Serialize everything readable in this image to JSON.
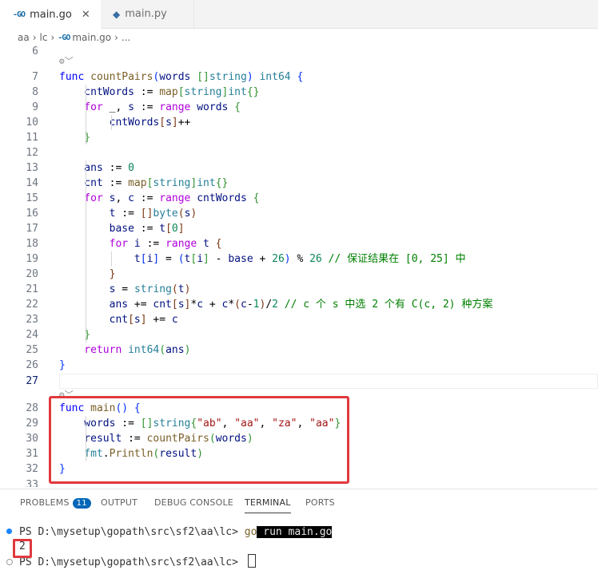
{
  "tabs": [
    {
      "icon": "go-file-icon",
      "label": "main.go",
      "active": true
    },
    {
      "icon": "python-file-icon",
      "label": "main.py",
      "active": false
    }
  ],
  "tab_close_glyph": "✕",
  "breadcrumb": {
    "items": [
      "aa",
      "lc",
      "main.go",
      "..."
    ]
  },
  "codelens_glyph": "⚙︎",
  "editor": {
    "line_numbers": [
      "6",
      "7",
      "8",
      "9",
      "10",
      "11",
      "12",
      "13",
      "14",
      "15",
      "16",
      "17",
      "18",
      "19",
      "20",
      "21",
      "22",
      "23",
      "24",
      "25",
      "26",
      "27",
      "28",
      "29",
      "30",
      "31",
      "32",
      "33"
    ],
    "current_line": "27",
    "lines": {
      "l7": [
        [
          "kw",
          "func"
        ],
        [
          "",
          ""
        ],
        [
          "fn",
          " countPairs"
        ],
        [
          "br1",
          "("
        ],
        [
          "var",
          "words"
        ],
        [
          "",
          ""
        ],
        [
          "",
          ""
        ],
        [
          "br2",
          " []"
        ],
        [
          "ty",
          "string"
        ],
        [
          "br1",
          ")"
        ],
        [
          "ty",
          " int64"
        ],
        [
          "br1",
          " {"
        ]
      ],
      "l8": [
        [
          "var",
          "    cntWords"
        ],
        [
          "",
          " := "
        ],
        [
          "fn",
          "map"
        ],
        [
          "br2",
          "["
        ],
        [
          "ty",
          "string"
        ],
        [
          "br2",
          "]"
        ],
        [
          "ty",
          "int"
        ],
        [
          "br2",
          "{}"
        ]
      ],
      "l9": [
        [
          "ctl",
          "    for"
        ],
        [
          "",
          " _, "
        ],
        [
          "var",
          "s"
        ],
        [
          "",
          " := "
        ],
        [
          "ctl",
          "range"
        ],
        [
          "var",
          " words"
        ],
        [
          "br2",
          " {"
        ]
      ],
      "l10": [
        [
          "var",
          "        cntWords"
        ],
        [
          "br3",
          "["
        ],
        [
          "var",
          "s"
        ],
        [
          "br3",
          "]"
        ],
        [
          "",
          "++"
        ]
      ],
      "l11": [
        [
          "br2",
          "    }"
        ]
      ],
      "l13": [
        [
          "var",
          "    ans"
        ],
        [
          "",
          " := "
        ],
        [
          "num",
          "0"
        ]
      ],
      "l14": [
        [
          "var",
          "    cnt"
        ],
        [
          "",
          " := "
        ],
        [
          "fn",
          "map"
        ],
        [
          "br2",
          "["
        ],
        [
          "ty",
          "string"
        ],
        [
          "br2",
          "]"
        ],
        [
          "ty",
          "int"
        ],
        [
          "br2",
          "{}"
        ]
      ],
      "l15": [
        [
          "ctl",
          "    for"
        ],
        [
          "var",
          " s"
        ],
        [
          ", ",
          ""
        ],
        [
          "var",
          "c"
        ],
        [
          "",
          " := "
        ],
        [
          "ctl",
          "range"
        ],
        [
          "var",
          " cntWords"
        ],
        [
          "br2",
          " {"
        ]
      ],
      "l16": [
        [
          "var",
          "        t"
        ],
        [
          "",
          " := "
        ],
        [
          "br3",
          "[]"
        ],
        [
          "ty",
          "byte"
        ],
        [
          "br3",
          "("
        ],
        [
          "var",
          "s"
        ],
        [
          "br3",
          ")"
        ]
      ],
      "l17": [
        [
          "var",
          "        base"
        ],
        [
          "",
          " := "
        ],
        [
          "var",
          "t"
        ],
        [
          "br3",
          "["
        ],
        [
          "num",
          "0"
        ],
        [
          "br3",
          "]"
        ]
      ],
      "l18": [
        [
          "ctl",
          "        for"
        ],
        [
          "var",
          " i"
        ],
        [
          "",
          " := "
        ],
        [
          "ctl",
          "range"
        ],
        [
          "var",
          " t"
        ],
        [
          "br3",
          " {"
        ]
      ],
      "l19": [
        [
          "var",
          "            t"
        ],
        [
          "br1",
          "["
        ],
        [
          "var",
          "i"
        ],
        [
          "br1",
          "]"
        ],
        [
          "",
          " = "
        ],
        [
          "br1",
          "("
        ],
        [
          "var",
          "t"
        ],
        [
          "br2",
          "["
        ],
        [
          "var",
          "i"
        ],
        [
          "br2",
          "]"
        ],
        [
          "",
          " - "
        ],
        [
          "var",
          "base"
        ],
        [
          "",
          " + "
        ],
        [
          "num",
          "26"
        ],
        [
          "br1",
          ")"
        ],
        [
          "",
          " % "
        ],
        [
          "num",
          "26"
        ],
        [
          "cm",
          " // 保证结果在 [0, 25] 中"
        ]
      ],
      "l20": [
        [
          "br3",
          "        }"
        ]
      ],
      "l21": [
        [
          "var",
          "        s"
        ],
        [
          "",
          " = "
        ],
        [
          "ty",
          "string"
        ],
        [
          "br3",
          "("
        ],
        [
          "var",
          "t"
        ],
        [
          "br3",
          ")"
        ]
      ],
      "l22": [
        [
          "var",
          "        ans"
        ],
        [
          "",
          " += "
        ],
        [
          "var",
          "cnt"
        ],
        [
          "br3",
          "["
        ],
        [
          "var",
          "s"
        ],
        [
          "br3",
          "]"
        ],
        [
          "",
          "*"
        ],
        [
          "var",
          "c"
        ],
        [
          "",
          " + "
        ],
        [
          "var",
          "c"
        ],
        [
          "",
          "*"
        ],
        [
          "br3",
          "("
        ],
        [
          "var",
          "c"
        ],
        [
          "",
          "-"
        ],
        [
          "num",
          "1"
        ],
        [
          "br3",
          ")"
        ],
        [
          "",
          "/"
        ],
        [
          "num",
          "2"
        ],
        [
          "cm",
          " // c 个 s 中选 2 个有 C(c, 2) 种方案"
        ]
      ],
      "l23": [
        [
          "var",
          "        cnt"
        ],
        [
          "br3",
          "["
        ],
        [
          "var",
          "s"
        ],
        [
          "br3",
          "]"
        ],
        [
          "",
          " += "
        ],
        [
          "var",
          "c"
        ]
      ],
      "l24": [
        [
          "br2",
          "    }"
        ]
      ],
      "l25": [
        [
          "ctl",
          "    return"
        ],
        [
          "ty",
          " int64"
        ],
        [
          "br2",
          "("
        ],
        [
          "var",
          "ans"
        ],
        [
          "br2",
          ")"
        ]
      ],
      "l26": [
        [
          "br1",
          "}"
        ]
      ],
      "l28": [
        [
          "kw",
          "func"
        ],
        [
          "fn",
          " main"
        ],
        [
          "br1",
          "()"
        ],
        [
          "br1",
          " {"
        ]
      ],
      "l29": [
        [
          "var",
          "    words"
        ],
        [
          "",
          " := "
        ],
        [
          "br2",
          "[]"
        ],
        [
          "ty",
          "string"
        ],
        [
          "br2",
          "{"
        ],
        [
          "str",
          "\"ab\""
        ],
        [
          "",
          ", "
        ],
        [
          "str",
          "\"aa\""
        ],
        [
          "",
          ", "
        ],
        [
          "str",
          "\"za\""
        ],
        [
          "",
          ", "
        ],
        [
          "str",
          "\"aa\""
        ],
        [
          "br2",
          "}"
        ]
      ],
      "l30": [
        [
          "var",
          "    result"
        ],
        [
          "",
          " := "
        ],
        [
          "fn",
          "countPairs"
        ],
        [
          "br2",
          "("
        ],
        [
          "var",
          "words"
        ],
        [
          "br2",
          ")"
        ]
      ],
      "l31": [
        [
          "ty",
          "    fmt"
        ],
        [
          "",
          "."
        ],
        [
          "fn",
          "Println"
        ],
        [
          "br2",
          "("
        ],
        [
          "var",
          "result"
        ],
        [
          "br2",
          ")"
        ]
      ],
      "l32": [
        [
          "br1",
          "}"
        ]
      ]
    }
  },
  "panel": {
    "tabs": [
      {
        "label": "PROBLEMS",
        "badge": "11"
      },
      {
        "label": "OUTPUT"
      },
      {
        "label": "DEBUG CONSOLE"
      },
      {
        "label": "TERMINAL",
        "active": true
      },
      {
        "label": "PORTS"
      }
    ]
  },
  "terminal": {
    "prompt1": "PS D:\\mysetup\\gopath\\src\\sf2\\aa\\lc> ",
    "cmd_go": "go",
    "cmd_rest": " run main.go",
    "output": "2",
    "prompt2": "PS D:\\mysetup\\gopath\\src\\sf2\\aa\\lc> "
  },
  "colors": {
    "highlight_box": "#e0393e",
    "badge": "#0066b8"
  }
}
